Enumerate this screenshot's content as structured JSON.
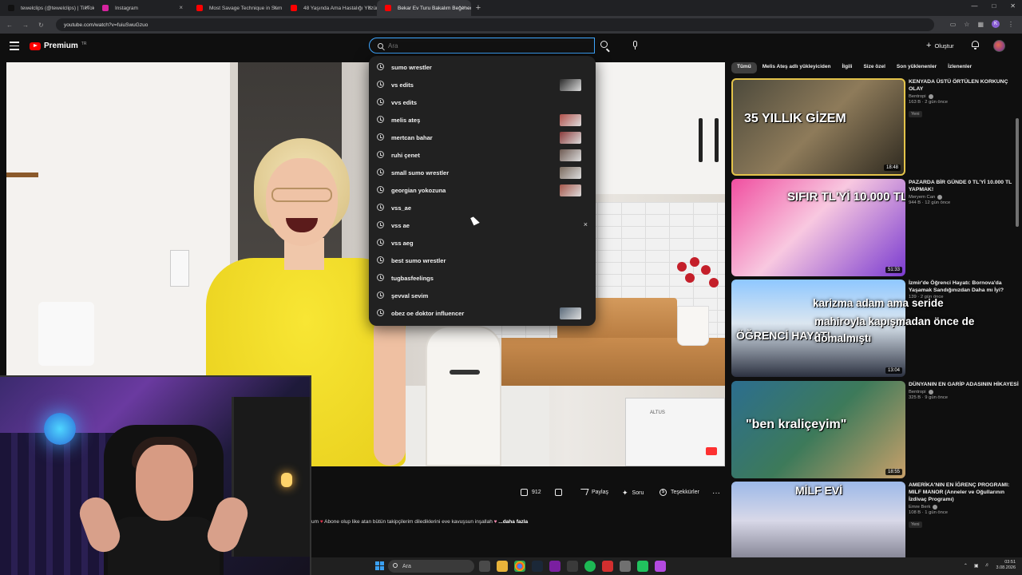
{
  "browser": {
    "tabs": [
      {
        "title": "tewelclips (@tewelclips) | TikTok",
        "fav": "#111111"
      },
      {
        "title": "Instagram",
        "fav": "#d6249f"
      },
      {
        "title": "Most Savage Technique in Sum",
        "fav": "#ff0000"
      },
      {
        "title": "48 Yaşında Ama Hastalığı Yüzün",
        "fav": "#ff0000"
      },
      {
        "title": "Bekar Ev Turu Bakalım Beğenec",
        "fav": "#ff0000",
        "active": true
      }
    ],
    "new_tab": "+",
    "url": "youtube.com/watch?v=fuiuSwuGzuo",
    "profile_initial": "K"
  },
  "header": {
    "logo_text": "Premium",
    "logo_sup": "TR",
    "search_placeholder": "Ara",
    "create_label": "Oluştur"
  },
  "suggestions": [
    {
      "text": "sumo wrestler",
      "thumb": null
    },
    {
      "text": "vs edits",
      "thumb": "#2a2a2a"
    },
    {
      "text": "vvs edits",
      "thumb": null
    },
    {
      "text": "melis ateş",
      "thumb": "#b0504a"
    },
    {
      "text": "mertcan bahar",
      "thumb": "#8a3a3a"
    },
    {
      "text": "ruhi çenet",
      "thumb": "#6e5a52"
    },
    {
      "text": "small sumo wrestler",
      "thumb": "#7b6a5e"
    },
    {
      "text": "georgian yokozuna",
      "thumb": "#a5564a"
    },
    {
      "text": "vss_ae",
      "thumb": null
    },
    {
      "text": "vss ae",
      "thumb": null,
      "removable": true
    },
    {
      "text": "vss aeg",
      "thumb": null
    },
    {
      "text": "best sumo wrestler",
      "thumb": null
    },
    {
      "text": "tugbasfeelings",
      "thumb": null
    },
    {
      "text": "şevval sevim",
      "thumb": null
    },
    {
      "text": "obez oe doktor influencer",
      "thumb": "#5a6a7a"
    }
  ],
  "remove_glyph": "×",
  "video": {
    "actions": {
      "likes": "912",
      "share": "Paylaş",
      "ask": "Soru",
      "thanks": "Teşekkürler",
      "more": "···"
    },
    "description_start": "um",
    "description_rest": "Abone olup like atan bütün takipçilerim dilediklerini eve kavuşsun inşallah",
    "description_more": "...daha fazla",
    "watermark": "ALTUS"
  },
  "chips": [
    {
      "label": "Tümü",
      "active": true
    },
    {
      "label": "Melis Ateş adlı yükleyiciden",
      "active": false
    },
    {
      "label": "İlgili",
      "active": false
    },
    {
      "label": "Size özel",
      "active": false
    },
    {
      "label": "Son yüklenenler",
      "active": false
    },
    {
      "label": "İzlenenler",
      "active": false
    }
  ],
  "recommendations": [
    {
      "title": "KENYADA ÜSTÜ ÖRTÜLEN KORKUNÇ OLAY",
      "channel": "Bentropi",
      "stats": "163 B · 2 gün önce",
      "badge": "Yeni",
      "duration": "18:48",
      "overlay": "35 YILLIK GİZEM",
      "selected": true
    },
    {
      "title": "PAZARDA BİR GÜNDE 0 TL'Yİ 10.000 TL YAPMAK!",
      "channel": "Meryem Can",
      "stats": "944 B · 12 gün önce",
      "badge": "",
      "duration": "51:33",
      "overlay": "SIFIR TL'Yİ 10.000 TL YAPTIM!",
      "selected": false
    },
    {
      "title": "İzmir'de Öğrenci Hayatı: Bornova'da Yaşamak Sandığınızdan Daha mı İyi?",
      "channel": "",
      "stats": "139 · 2 gün önce",
      "badge": "",
      "duration": "13:04",
      "overlay": "ÖĞRENCİ HAYATI",
      "selected": false
    },
    {
      "title": "DÜNYANIN EN GARİP ADASININ HİKAYESİ",
      "channel": "Bentropi",
      "stats": "325 B · 9 gün önce",
      "badge": "",
      "duration": "18:55",
      "overlay": "\"ben kraliçeyim\"",
      "selected": false
    },
    {
      "title": "AMERİKA'NIN EN İĞRENÇ PROGRAMI: MILF MANOR (Anneler ve Oğullarının İzdivaç Programı)",
      "channel": "Emre Berk",
      "stats": "108 B · 1 gün önce",
      "badge": "Yeni",
      "duration": "",
      "overlay": "MİLF EVİ",
      "selected": false
    }
  ],
  "caption_overlay": {
    "line1_pre": "",
    "line1_hl": "",
    "line1": "karizma adam ama seride",
    "line2_hl": "",
    "line2": "mahiroyla kapışmadan önce de",
    "line3": "domalmıştı"
  },
  "taskbar": {
    "search_label": "Ara",
    "time": "03:51",
    "date": "3.08.2026"
  },
  "colors": {
    "youtube_red": "#ff0000",
    "accent_blue": "#3ea6ff",
    "selected_border": "#e3c34a"
  }
}
